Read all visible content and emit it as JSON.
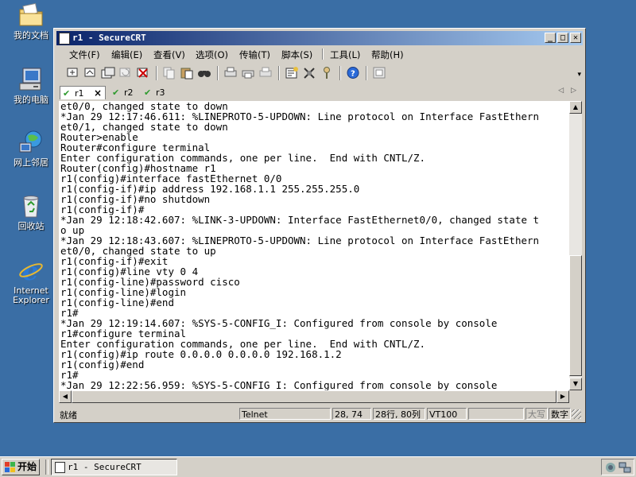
{
  "desktop": {
    "icons": [
      {
        "label": "我的文档"
      },
      {
        "label": "我的电脑"
      },
      {
        "label": "网上邻居"
      },
      {
        "label": "回收站"
      },
      {
        "label_line1": "Internet",
        "label_line2": "Explorer"
      }
    ]
  },
  "window": {
    "title": "r1 - SecureCRT",
    "menu": [
      "文件(F)",
      "编辑(E)",
      "查看(V)",
      "选项(O)",
      "传输(T)",
      "脚本(S)",
      "工具(L)",
      "帮助(H)"
    ],
    "tabs": [
      {
        "label": "r1",
        "active": true
      },
      {
        "label": "r2",
        "active": false
      },
      {
        "label": "r3",
        "active": false
      }
    ],
    "terminal_lines": [
      "et0/0, changed state to down",
      "*Jan 29 12:17:46.611: %LINEPROTO-5-UPDOWN: Line protocol on Interface FastEthern",
      "et0/1, changed state to down",
      "Router>enable",
      "Router#configure terminal",
      "Enter configuration commands, one per line.  End with CNTL/Z.",
      "Router(config)#hostname r1",
      "r1(config)#interface fastEthernet 0/0",
      "r1(config-if)#ip address 192.168.1.1 255.255.255.0",
      "r1(config-if)#no shutdown",
      "r1(config-if)#",
      "*Jan 29 12:18:42.607: %LINK-3-UPDOWN: Interface FastEthernet0/0, changed state t",
      "o up",
      "*Jan 29 12:18:43.607: %LINEPROTO-5-UPDOWN: Line protocol on Interface FastEthern",
      "et0/0, changed state to up",
      "r1(config-if)#exit",
      "r1(config)#line vty 0 4",
      "r1(config-line)#password cisco",
      "r1(config-line)#login",
      "r1(config-line)#end",
      "r1#",
      "*Jan 29 12:19:14.607: %SYS-5-CONFIG_I: Configured from console by console",
      "r1#configure terminal",
      "Enter configuration commands, one per line.  End with CNTL/Z.",
      "r1(config)#ip route 0.0.0.0 0.0.0.0 192.168.1.2",
      "r1(config)#end",
      "r1#",
      "*Jan 29 12:22:56.959: %SYS-5-CONFIG_I: Configured from console by console"
    ],
    "status": {
      "ready": "就绪",
      "protocol": "Telnet",
      "cursor": "28, 74",
      "size": "28行, 80列",
      "emulation": "VT100",
      "caps": "大写",
      "num": "数字"
    }
  },
  "taskbar": {
    "start_label": "开始",
    "task_item_label": "r1 - SecureCRT"
  },
  "colors": {
    "desktop": "#3a6ea5",
    "title_active_start": "#0a246a",
    "title_active_end": "#a6caf0",
    "tab_check": "#2e9a2e"
  }
}
